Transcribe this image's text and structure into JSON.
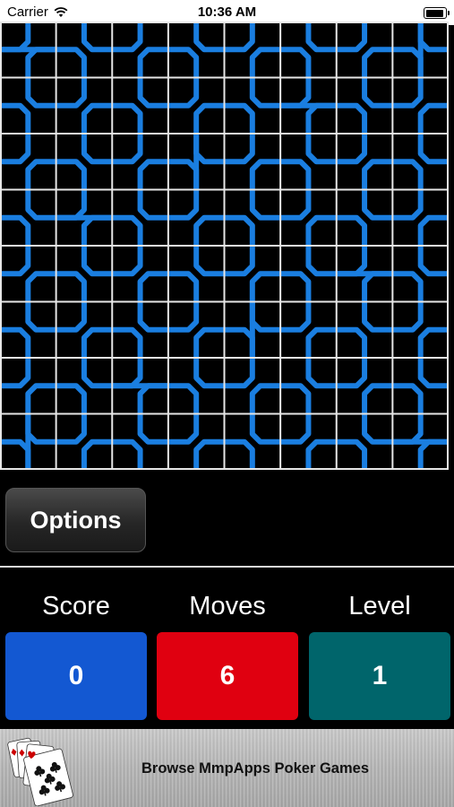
{
  "status_bar": {
    "carrier": "Carrier",
    "time": "10:36 AM"
  },
  "board": {
    "grid_columns": 8,
    "grid_rows": 8,
    "pipe_color": "#1a7ee0",
    "grid_line_color": "#e6e6e6",
    "background_color": "#000000"
  },
  "options": {
    "label": "Options"
  },
  "stats": {
    "score_label": "Score",
    "score_value": "0",
    "score_color": "#1358d2",
    "moves_label": "Moves",
    "moves_value": "6",
    "moves_color": "#e00010",
    "level_label": "Level",
    "level_value": "1",
    "level_color": "#00656b"
  },
  "ad": {
    "text": "Browse MmpApps Poker Games",
    "icon": "playing-cards-icon"
  }
}
